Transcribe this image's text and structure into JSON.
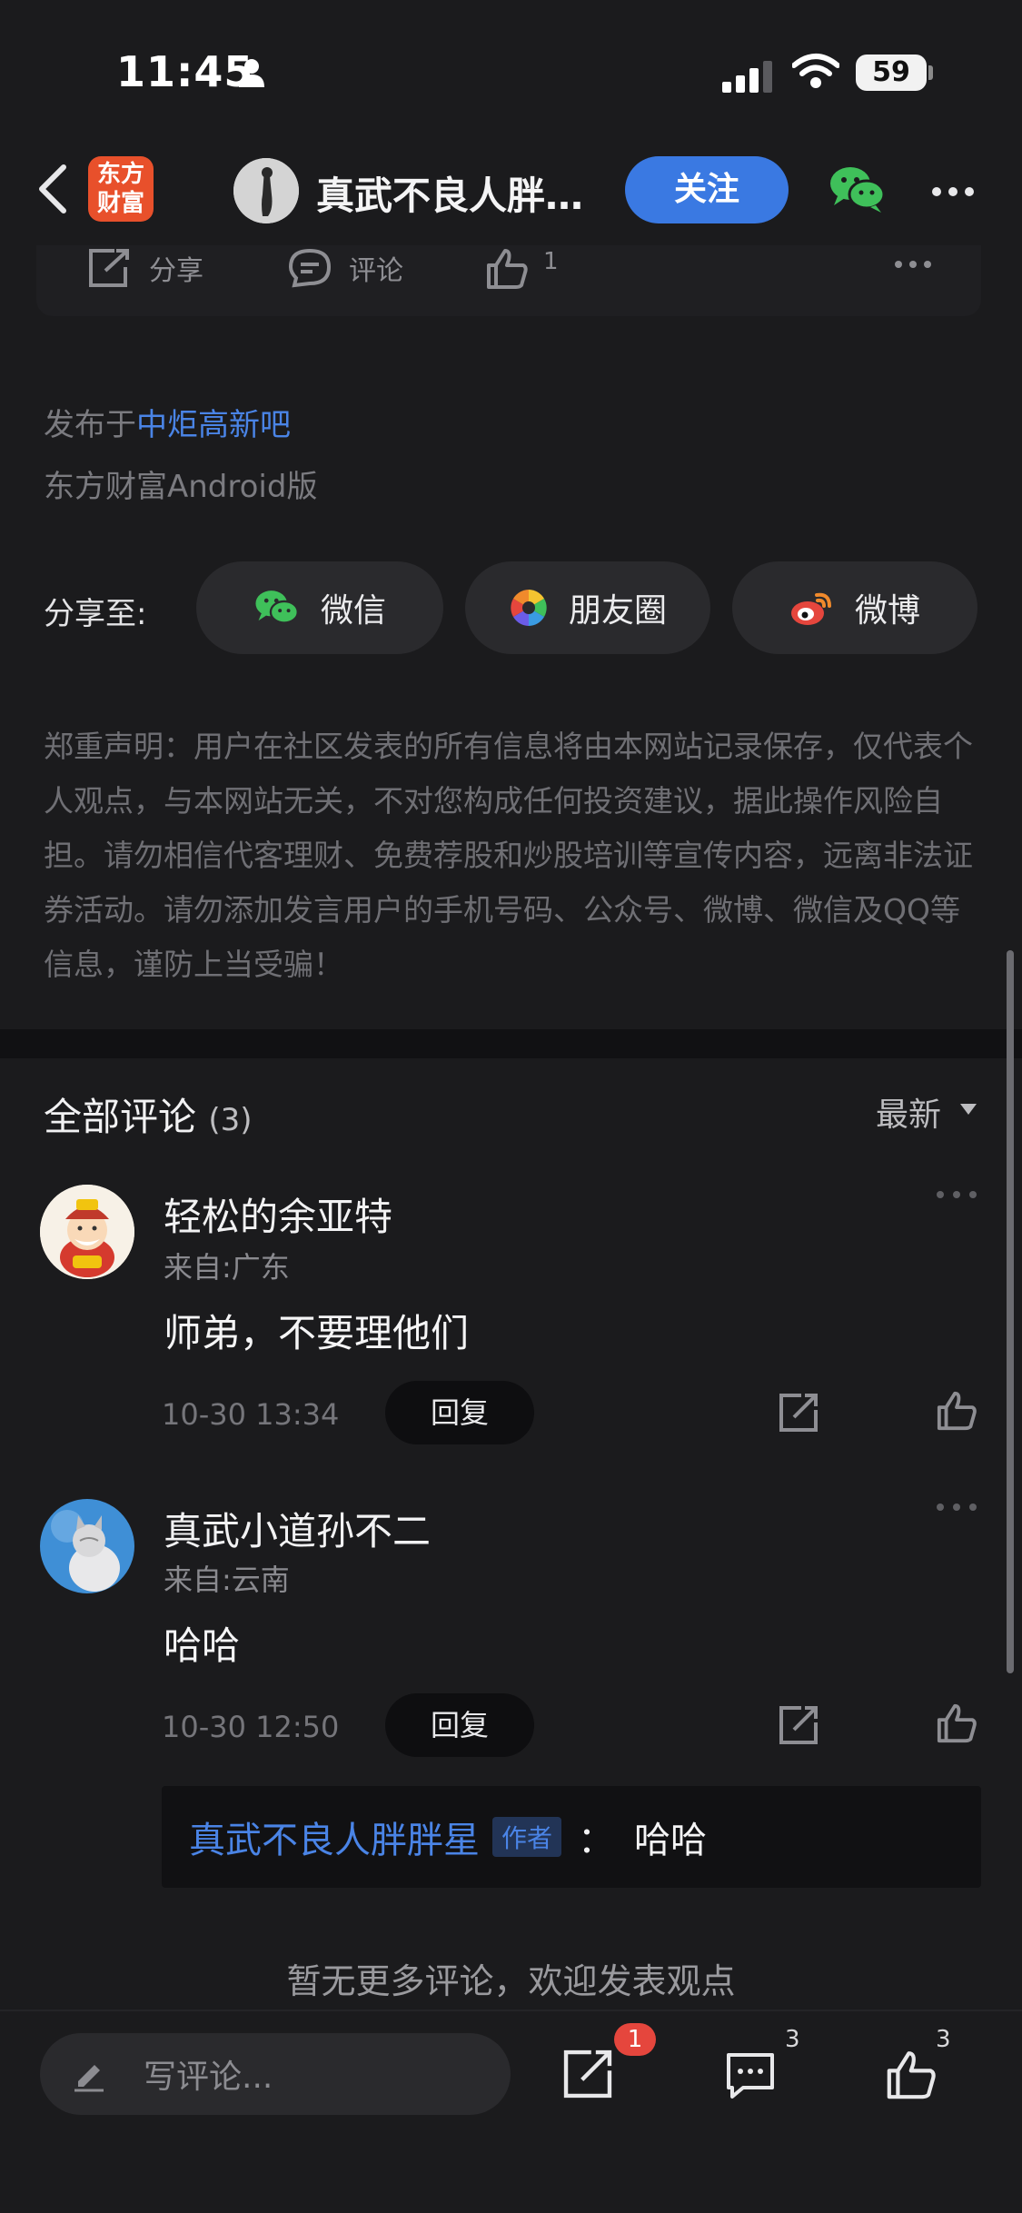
{
  "status_bar": {
    "time": "11:45",
    "battery": "59"
  },
  "nav": {
    "app_logo_line1": "东方",
    "app_logo_line2": "财富",
    "author_name": "真武不良人胖…",
    "follow_label": "关注"
  },
  "post_actions": {
    "share_label": "分享",
    "comment_label": "评论",
    "like_count": "1"
  },
  "post_meta": {
    "posted_in_prefix": "发布于",
    "posted_in_link": "中炬高新吧",
    "client": "东方财富Android版"
  },
  "share": {
    "label": "分享至:",
    "options": [
      "微信",
      "朋友圈",
      "微博"
    ]
  },
  "disclaimer": "郑重声明：用户在社区发表的所有信息将由本网站记录保存，仅代表个人观点，与本网站无关，不对您构成任何投资建议，据此操作风险自担。请勿相信代客理财、免费荐股和炒股培训等宣传内容，远离非法证券活动。请勿添加发言用户的手机号码、公众号、微博、微信及QQ等信息，谨防上当受骗！",
  "comments": {
    "title": "全部评论",
    "count": "(3)",
    "sort_label": "最新",
    "items": [
      {
        "name": "轻松的余亚特",
        "location": "来自:广东",
        "text": "师弟，不要理他们",
        "time": "10-30 13:34",
        "reply_label": "回复"
      },
      {
        "name": "真武小道孙不二",
        "location": "来自:云南",
        "text": "哈哈",
        "time": "10-30 12:50",
        "reply_label": "回复"
      }
    ],
    "sub_reply": {
      "author": "真武不良人胖胖星",
      "tag": "作者",
      "colon": "：",
      "text": "哈哈"
    },
    "no_more": "暂无更多评论，欢迎发表观点"
  },
  "bottom_bar": {
    "input_placeholder": "写评论...",
    "share_badge": "1",
    "comment_count": "3",
    "like_count": "3"
  },
  "colors": {
    "accent": "#3a79e2",
    "link": "#4a84e6",
    "badge": "#e5463d",
    "logo": "#e8502b"
  }
}
